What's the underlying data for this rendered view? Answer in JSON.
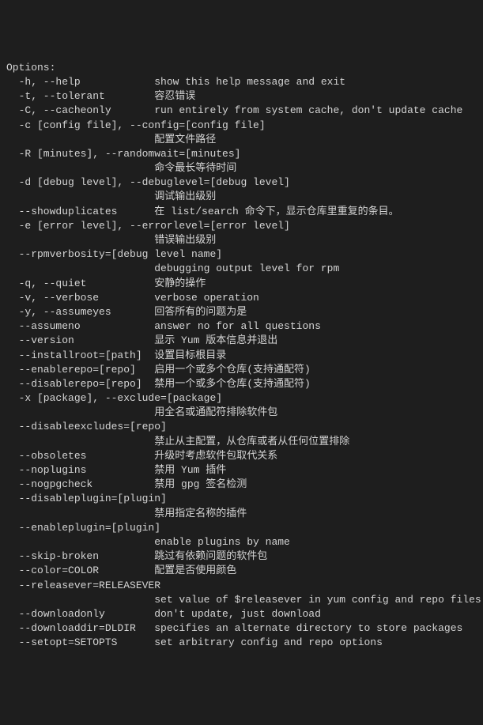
{
  "header": "Options:",
  "lines": [
    {
      "flag": "  -h, --help",
      "desc": "show this help message and exit"
    },
    {
      "flag": "  -t, --tolerant",
      "desc": "容忍错误"
    },
    {
      "flag": "  -C, --cacheonly",
      "desc": "run entirely from system cache, don't update cache"
    },
    {
      "flag": "  -c [config file], --config=[config file]",
      "desc": ""
    },
    {
      "flag": "",
      "desc": "配置文件路径"
    },
    {
      "flag": "  -R [minutes], --randomwait=[minutes]",
      "desc": ""
    },
    {
      "flag": "",
      "desc": "命令最长等待时间"
    },
    {
      "flag": "  -d [debug level], --debuglevel=[debug level]",
      "desc": ""
    },
    {
      "flag": "",
      "desc": "调试输出级别"
    },
    {
      "flag": "  --showduplicates",
      "desc": "在 list/search 命令下，显示仓库里重复的条目。"
    },
    {
      "flag": "  -e [error level], --errorlevel=[error level]",
      "desc": ""
    },
    {
      "flag": "",
      "desc": "错误输出级别"
    },
    {
      "flag": "  --rpmverbosity=[debug level name]",
      "desc": ""
    },
    {
      "flag": "",
      "desc": "debugging output level for rpm"
    },
    {
      "flag": "  -q, --quiet",
      "desc": "安静的操作"
    },
    {
      "flag": "  -v, --verbose",
      "desc": "verbose operation"
    },
    {
      "flag": "  -y, --assumeyes",
      "desc": "回答所有的问题为是"
    },
    {
      "flag": "  --assumeno",
      "desc": "answer no for all questions"
    },
    {
      "flag": "  --version",
      "desc": "显示 Yum 版本信息并退出"
    },
    {
      "flag": "  --installroot=[path]",
      "desc": "设置目标根目录"
    },
    {
      "flag": "  --enablerepo=[repo]",
      "desc": "启用一个或多个仓库(支持通配符)"
    },
    {
      "flag": "  --disablerepo=[repo]",
      "desc": "禁用一个或多个仓库(支持通配符)"
    },
    {
      "flag": "  -x [package], --exclude=[package]",
      "desc": ""
    },
    {
      "flag": "",
      "desc": "用全名或通配符排除软件包"
    },
    {
      "flag": "  --disableexcludes=[repo]",
      "desc": ""
    },
    {
      "flag": "",
      "desc": "禁止从主配置，从仓库或者从任何位置排除"
    },
    {
      "flag": "  --obsoletes",
      "desc": "升级时考虑软件包取代关系"
    },
    {
      "flag": "  --noplugins",
      "desc": "禁用 Yum 插件"
    },
    {
      "flag": "  --nogpgcheck",
      "desc": "禁用 gpg 签名检测"
    },
    {
      "flag": "  --disableplugin=[plugin]",
      "desc": ""
    },
    {
      "flag": "",
      "desc": "禁用指定名称的插件"
    },
    {
      "flag": "  --enableplugin=[plugin]",
      "desc": ""
    },
    {
      "flag": "",
      "desc": "enable plugins by name"
    },
    {
      "flag": "  --skip-broken",
      "desc": "跳过有依赖问题的软件包"
    },
    {
      "flag": "  --color=COLOR",
      "desc": "配置是否使用颜色"
    },
    {
      "flag": "  --releasever=RELEASEVER",
      "desc": ""
    },
    {
      "flag": "",
      "desc": "set value of $releasever in yum config and repo files"
    },
    {
      "flag": "  --downloadonly",
      "desc": "don't update, just download"
    },
    {
      "flag": "  --downloaddir=DLDIR",
      "desc": "specifies an alternate directory to store packages"
    },
    {
      "flag": "  --setopt=SETOPTS",
      "desc": "set arbitrary config and repo options"
    }
  ]
}
